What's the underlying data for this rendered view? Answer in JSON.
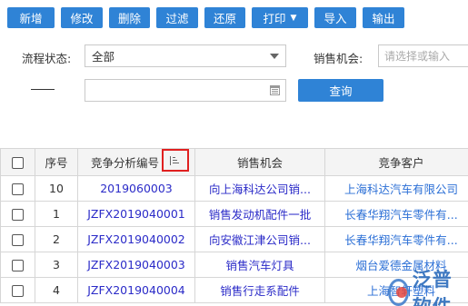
{
  "toolbar": {
    "buttons": [
      {
        "label": "新增"
      },
      {
        "label": "修改"
      },
      {
        "label": "删除"
      },
      {
        "label": "过滤"
      },
      {
        "label": "还原"
      },
      {
        "label": "打印"
      },
      {
        "label": "导入"
      },
      {
        "label": "输出"
      }
    ]
  },
  "filters": {
    "flow_status_label": "流程状态:",
    "flow_status_value": "全部",
    "opportunity_label": "销售机会:",
    "opportunity_placeholder": "请选择或输入",
    "range_separator": "——",
    "query_label": "查询"
  },
  "table": {
    "columns": [
      "序号",
      "竞争分析编号",
      "销售机会",
      "竞争客户"
    ],
    "rows": [
      {
        "seq": "10",
        "code": "2019060003",
        "opportunity": "向上海科达公司销...",
        "customer": "上海科达汽车有限公司"
      },
      {
        "seq": "1",
        "code": "JZFX2019040001",
        "opportunity": "销售发动机配件一批",
        "customer": "长春华翔汽车零件有..."
      },
      {
        "seq": "2",
        "code": "JZFX2019040002",
        "opportunity": "向安徽江津公司销...",
        "customer": "长春华翔汽车零件有..."
      },
      {
        "seq": "3",
        "code": "JZFX2019040003",
        "opportunity": "销售汽车灯具",
        "customer": "烟台爱德金属材料"
      },
      {
        "seq": "4",
        "code": "JZFX2019040004",
        "opportunity": "销售行走系配件",
        "customer": "上海智轩塑料"
      }
    ]
  },
  "watermark": {
    "text": "泛普软件"
  }
}
